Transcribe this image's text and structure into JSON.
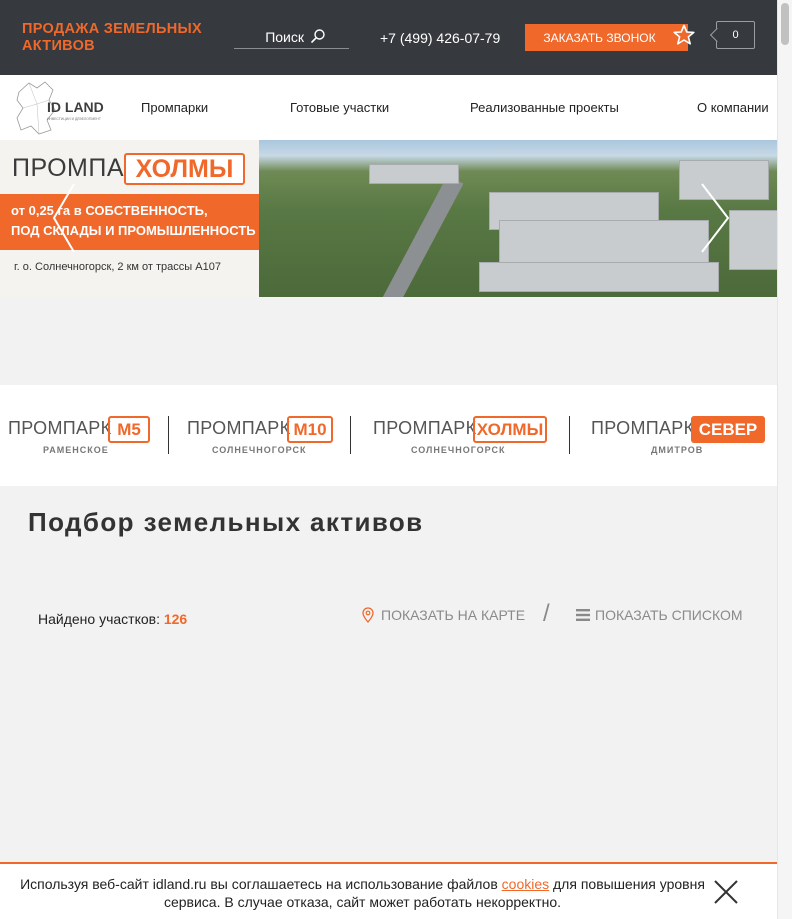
{
  "header": {
    "brand_line1": "ПРОДАЖА ЗЕМЕЛЬНЫХ",
    "brand_line2": "АКТИВОВ",
    "search_placeholder": "Поиск",
    "phone": "+7 (499) 426-07-79",
    "callback_label": "ЗАКАЗАТЬ ЗВОНОК",
    "cart_count": "0",
    "icons": [
      "search-icon",
      "star-icon"
    ]
  },
  "nav": {
    "logo_text": "ID LAND",
    "logo_sub": "ИНВЕСТИЦИИ И ДЕВЕЛОПМЕНТ",
    "items": [
      "Промпарки",
      "Готовые участки",
      "Реализованные проекты",
      "О компании"
    ]
  },
  "banner": {
    "word": "ПРОМПАРК",
    "badge": "ХОЛМЫ",
    "line1": "от 0,25 га в СОБСТВЕННОСТЬ,",
    "line2": "ПОД СКЛАДЫ И ПРОМЫШЛЕННОСТЬ",
    "location": "г. о. Солнечногорск, 2 км от трассы А107",
    "icons": [
      "chevron-left-icon",
      "chevron-right-icon"
    ]
  },
  "parks": [
    {
      "word": "ПРОМПАРК",
      "badge": "М5",
      "sub": "РАМЕНСКОЕ"
    },
    {
      "word": "ПРОМПАРК",
      "badge": "М10",
      "sub": "СОЛНЕЧНОГОРСК"
    },
    {
      "word": "ПРОМПАРК",
      "badge": "ХОЛМЫ",
      "sub": "СОЛНЕЧНОГОРСК"
    },
    {
      "word": "ПРОМПАРК",
      "badge": "СЕВЕР",
      "sub": "ДМИТРОВ"
    }
  ],
  "content": {
    "title": "Подбор земельных активов",
    "found_label": "Найдено участков:",
    "found_count": "126",
    "show_map": "ПОКАЗАТЬ НА КАРТЕ",
    "separator": "/",
    "show_list": "ПОКАЗАТЬ СПИСКОМ",
    "icons": [
      "map-pin-icon",
      "list-icon"
    ]
  },
  "cookie": {
    "text_before": "Используя веб-сайт idland.ru вы соглашаетесь на использование файлов ",
    "link": "cookies",
    "text_after": " для повышения уровня сервиса. В случае отказа, сайт может работать некорректно.",
    "icons": [
      "close-icon"
    ]
  },
  "colors": {
    "accent": "#f0682a",
    "topbar": "#36393d",
    "content_bg": "#f2f2f2"
  }
}
